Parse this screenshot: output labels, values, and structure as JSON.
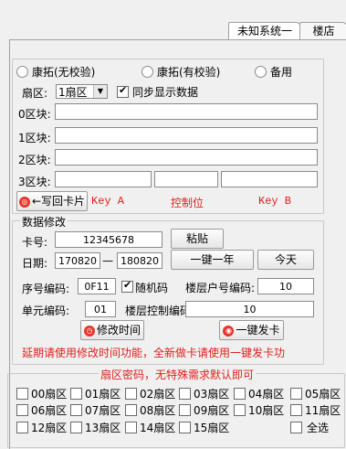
{
  "tabs": [
    {
      "label": "未知系统一"
    },
    {
      "label": "楼店"
    }
  ],
  "keys": {
    "radio1": "康拓(无校验)",
    "radio2": "康拓(有校验)",
    "radio3": "备用",
    "sector_label": "扇区:",
    "sector_value": "1扇区",
    "sync_label": "同步显示数据",
    "block0": "0区块:",
    "block1": "1区块:",
    "block2": "2区块:",
    "block3": "3区块:",
    "write_button": "←写回卡片",
    "key_a": "Key A",
    "control": "控制位",
    "key_b": "Key B"
  },
  "modify": {
    "title": "数据修改",
    "card_label": "卡号:",
    "card_value": "12345678",
    "paste_button": "粘贴",
    "date_label": "日期:",
    "date_from": "170820",
    "date_sep": "—",
    "date_to": "180820",
    "one_year_button": "一键一年",
    "today_button": "今天",
    "seq_label": "序号编码:",
    "seq_value": "0F11",
    "random_label": "随机码",
    "floor_room_label": "楼层户号编码:",
    "floor_room_value": "10",
    "unit_label": "单元编码:",
    "unit_value": "01",
    "floor_ctrl_label": "楼层控制编码:",
    "floor_ctrl_value": "10",
    "modify_time_button": "修改时间",
    "issue_card_button": "一键发卡",
    "hint": "延期请使用修改时间功能，全新做卡请使用一键发卡功"
  },
  "sectors": {
    "title": "扇区密码，无特殊需求默认即可",
    "items": [
      "00扇区",
      "01扇区",
      "02扇区",
      "03扇区",
      "04扇区",
      "05扇区",
      "06扇区",
      "07扇区",
      "08扇区",
      "09扇区",
      "10扇区",
      "11扇区",
      "12扇区",
      "13扇区",
      "14扇区",
      "15扇区"
    ],
    "select_all": "全选"
  }
}
